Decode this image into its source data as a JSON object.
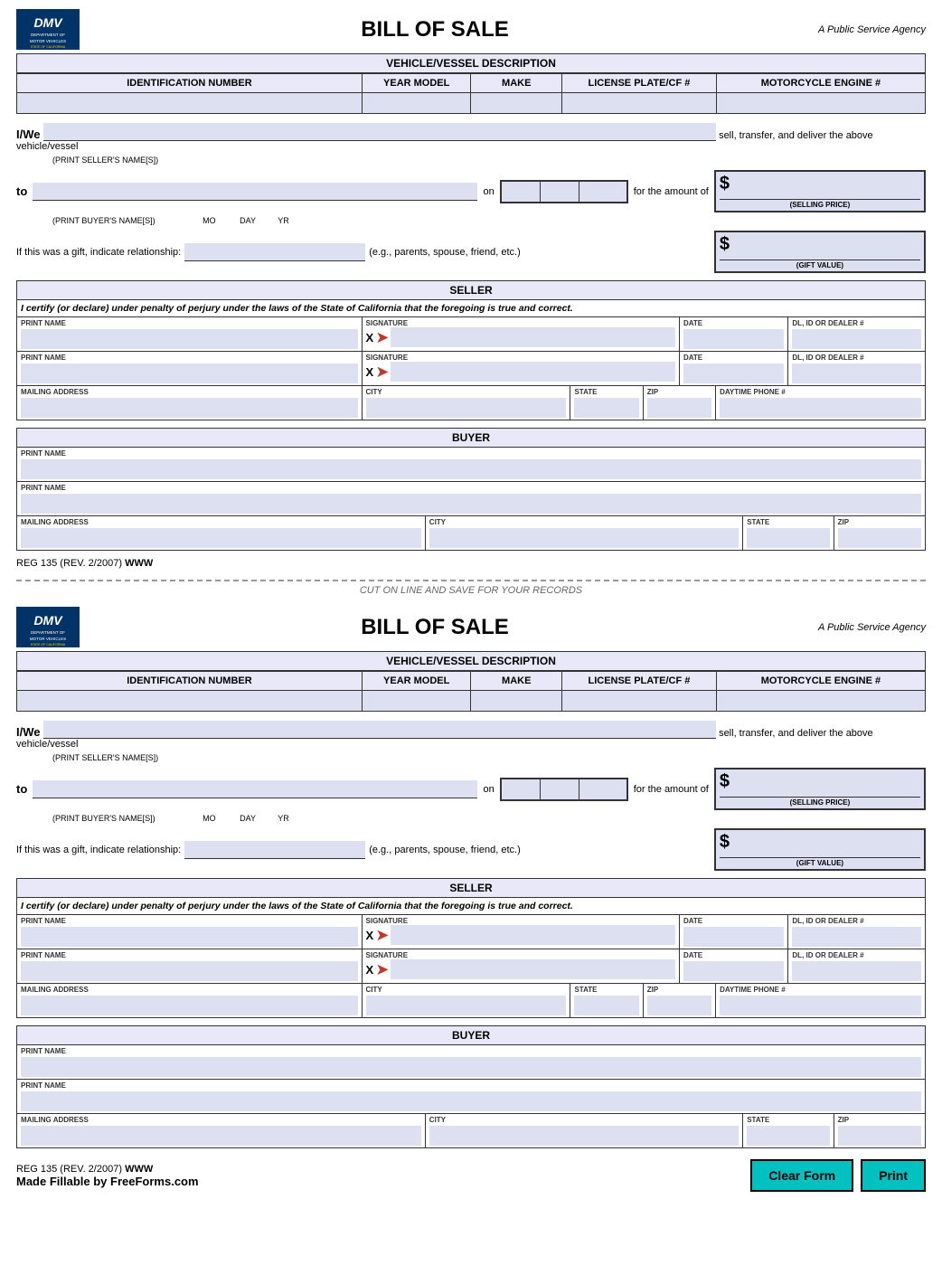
{
  "header": {
    "title": "BILL OF SALE",
    "agency": "A Public Service Agency",
    "logo_line1": "DMV",
    "logo_line2": "DEPARTMENT OF MOTOR VEHICLES"
  },
  "vehicle_section": {
    "label": "VEHICLE/VESSEL DESCRIPTION",
    "col1": "IDENTIFICATION NUMBER",
    "col2": "YEAR MODEL",
    "col3": "MAKE",
    "col4": "LICENSE PLATE/CF #",
    "col5": "MOTORCYCLE ENGINE #"
  },
  "form_text": {
    "iwe": "I/We",
    "seller_name_label": "(PRINT SELLER'S NAME[S])",
    "sell_text": "sell, transfer, and deliver the above vehicle/vessel",
    "to": "to",
    "on": "on",
    "for_amount": "for  the amount of",
    "mo": "MO",
    "day": "DAY",
    "yr": "YR",
    "selling_price_label": "(SELLING PRICE)",
    "gift_label": "If this was a gift, indicate relationship:",
    "gift_example": "(e.g., parents, spouse, friend, etc.)",
    "gift_value_label": "(GIFT VALUE)",
    "buyer_name_label": "(PRINT BUYER'S NAME[S])",
    "dollar": "$"
  },
  "seller_section": {
    "label": "SELLER",
    "statement": "I certify (or declare) under penalty of perjury under the laws of the State of California that the foregoing is true and correct.",
    "print_name": "PRINT NAME",
    "signature": "SIGNATURE",
    "date": "DATE",
    "dl_id": "DL, ID OR DEALER #",
    "x": "X",
    "mailing_address": "MAILING ADDRESS",
    "city": "CITY",
    "state": "STATE",
    "zip": "ZIP",
    "daytime_phone": "DAYTIME PHONE #"
  },
  "buyer_section": {
    "label": "BUYER",
    "print_name": "PRINT NAME",
    "mailing_address": "MAILING ADDRESS",
    "city": "CITY",
    "state": "STATE",
    "zip": "ZIP"
  },
  "footer": {
    "reg": "REG 135 (REV. 2/2007)",
    "www": "WWW",
    "cut_line": "CUT ON LINE AND SAVE FOR YOUR RECORDS"
  },
  "bottom": {
    "reg": "REG 135 (REV. 2/2007)",
    "www": "WWW",
    "made_by": "Made Fillable by FreeForms.com",
    "clear_btn": "Clear Form",
    "print_btn": "Print"
  }
}
